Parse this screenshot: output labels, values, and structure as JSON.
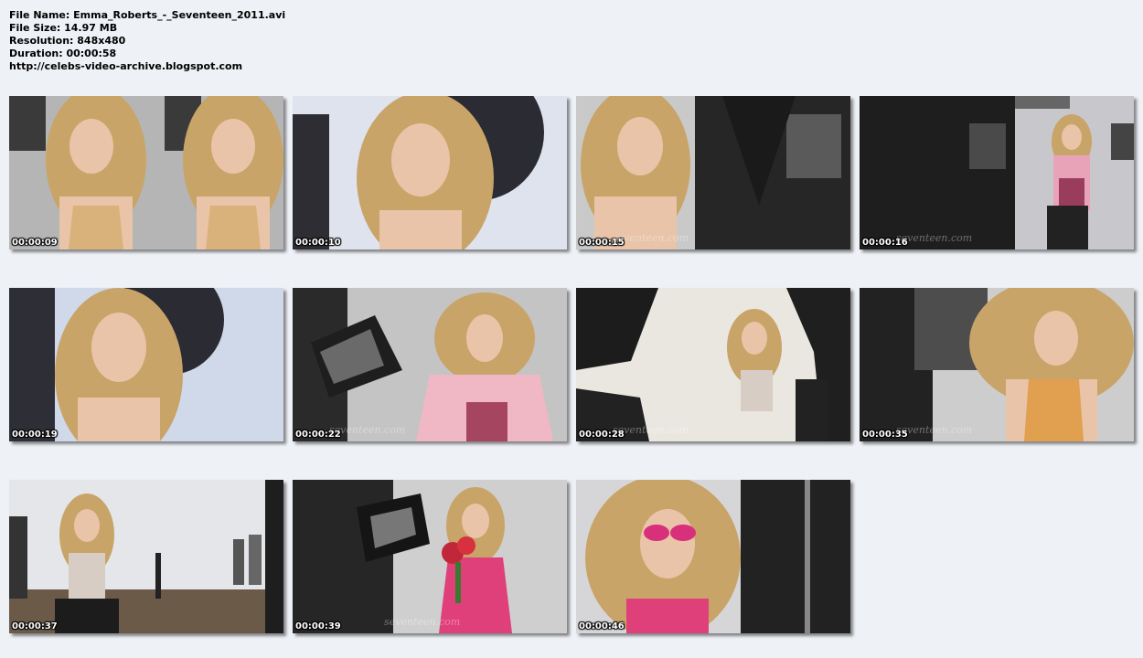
{
  "info": {
    "file_name": "File Name: Emma_Roberts_-_Seventeen_2011.avi",
    "file_size": "File Size: 14.97 MB",
    "resolution": "Resolution: 848x480",
    "duration": "Duration: 00:00:58",
    "url": "http://celebs-video-archive.blogspot.com"
  },
  "thumbnails": [
    {
      "timestamp": "00:00:09",
      "watermark": ""
    },
    {
      "timestamp": "00:00:10",
      "watermark": ""
    },
    {
      "timestamp": "00:00:15",
      "watermark": "seventeen.com"
    },
    {
      "timestamp": "00:00:16",
      "watermark": "seventeen.com"
    },
    {
      "timestamp": "00:00:19",
      "watermark": ""
    },
    {
      "timestamp": "00:00:22",
      "watermark": "seventeen.com"
    },
    {
      "timestamp": "00:00:28",
      "watermark": "seventeen.com"
    },
    {
      "timestamp": "00:00:35",
      "watermark": "seventeen.com"
    },
    {
      "timestamp": "00:00:37",
      "watermark": ""
    },
    {
      "timestamp": "00:00:39",
      "watermark": "seventeen.com"
    },
    {
      "timestamp": "00:00:46",
      "watermark": ""
    }
  ],
  "colors": {
    "page_background": "#eef1f6",
    "hair": "#c9a468",
    "skin": "#e9c4a8",
    "studio_gray": "#c8c8c8",
    "studio_dark": "#2a2a2a",
    "backdrop_blue": "#cfd9ea",
    "pink_top": "#e0407a"
  }
}
